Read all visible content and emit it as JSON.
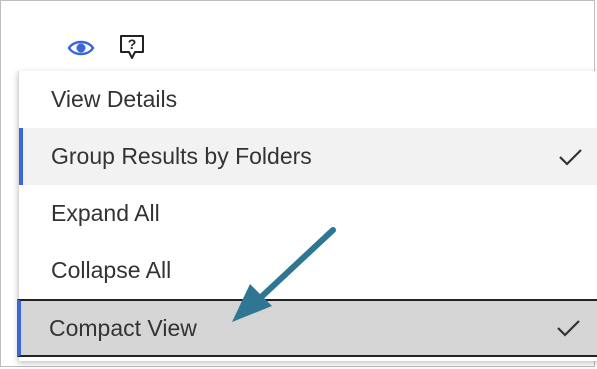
{
  "toolbar": {
    "view_icon": "eye-icon",
    "help_icon": "question-mark-icon",
    "accent_color": "#3a67d8"
  },
  "menu": {
    "items": [
      {
        "label": "View Details",
        "checked": false
      },
      {
        "label": "Group Results by Folders",
        "checked": true
      },
      {
        "label": "Expand All",
        "checked": false
      },
      {
        "label": "Collapse All",
        "checked": false
      },
      {
        "label": "Compact View",
        "checked": true
      }
    ]
  },
  "annotation": {
    "arrow_color": "#2e7691",
    "arrow_target": "Compact View"
  }
}
